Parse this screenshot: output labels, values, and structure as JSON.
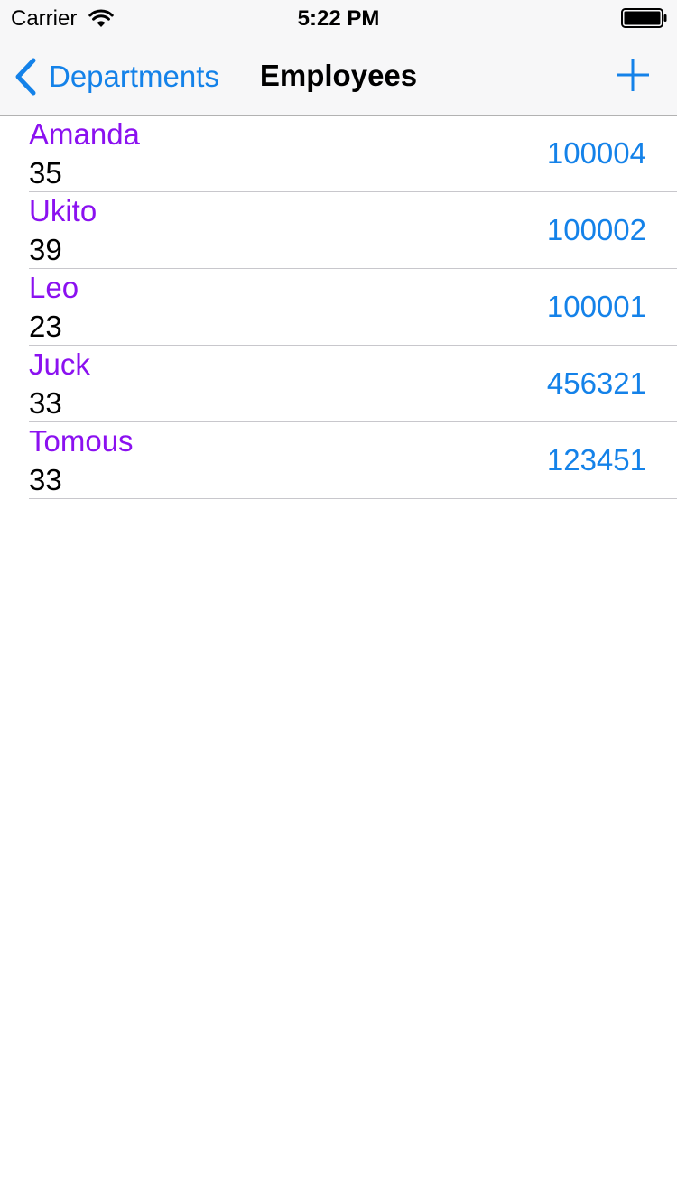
{
  "status_bar": {
    "carrier": "Carrier",
    "time": "5:22 PM",
    "icons": [
      "wifi-icon",
      "battery-icon"
    ]
  },
  "nav_bar": {
    "back_label": "Departments",
    "title": "Employees",
    "add_icon": "plus-icon"
  },
  "colors": {
    "accent": "#1482e9",
    "name_text": "#8b11f0",
    "bar_background": "#f7f7f8",
    "separator": "#c8c7cc"
  },
  "employees": [
    {
      "name": "Amanda",
      "age": "35",
      "id": "100004"
    },
    {
      "name": "Ukito",
      "age": "39",
      "id": "100002"
    },
    {
      "name": "Leo",
      "age": "23",
      "id": "100001"
    },
    {
      "name": "Juck",
      "age": "33",
      "id": "456321"
    },
    {
      "name": "Tomous",
      "age": "33",
      "id": "123451"
    }
  ]
}
